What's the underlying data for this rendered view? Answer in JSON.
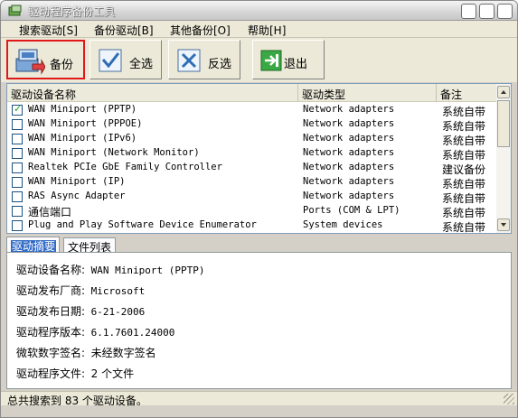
{
  "window": {
    "title": "驱动程序备份工具"
  },
  "menu": [
    {
      "label": "搜索驱动[S]"
    },
    {
      "label": "备份驱动[B]"
    },
    {
      "label": "其他备份[O]"
    },
    {
      "label": "帮助[H]"
    }
  ],
  "toolbar": {
    "backup_label": "备份",
    "select_all_label": "全选",
    "invert_label": "反选",
    "exit_label": "退出"
  },
  "list": {
    "columns": [
      "驱动设备名称",
      "驱动类型",
      "备注"
    ],
    "rows": [
      {
        "checked": true,
        "name": "WAN Miniport (PPTP)",
        "type": "Network adapters",
        "note": "系统自带"
      },
      {
        "checked": false,
        "name": "WAN Miniport (PPPOE)",
        "type": "Network adapters",
        "note": "系统自带"
      },
      {
        "checked": false,
        "name": "WAN Miniport (IPv6)",
        "type": "Network adapters",
        "note": "系统自带"
      },
      {
        "checked": false,
        "name": "WAN Miniport (Network Monitor)",
        "type": "Network adapters",
        "note": "系统自带"
      },
      {
        "checked": false,
        "name": "Realtek PCIe GbE Family Controller",
        "type": "Network adapters",
        "note": "建议备份"
      },
      {
        "checked": false,
        "name": "WAN Miniport (IP)",
        "type": "Network adapters",
        "note": "系统自带"
      },
      {
        "checked": false,
        "name": "RAS Async Adapter",
        "type": "Network adapters",
        "note": "系统自带"
      },
      {
        "checked": false,
        "name": "通信端口",
        "type": "Ports (COM & LPT)",
        "note": "系统自带"
      },
      {
        "checked": false,
        "name": "Plug and Play Software Device Enumerator",
        "type": "System devices",
        "note": "系统自带"
      }
    ]
  },
  "tabs": [
    {
      "label": "驱动摘要",
      "active": true
    },
    {
      "label": "文件列表",
      "active": false
    }
  ],
  "detail": {
    "rows": [
      {
        "key": "驱动设备名称:",
        "value": "WAN Miniport (PPTP)"
      },
      {
        "key": "驱动发布厂商:",
        "value": "Microsoft"
      },
      {
        "key": "驱动发布日期:",
        "value": "6-21-2006"
      },
      {
        "key": "驱动程序版本:",
        "value": "6.1.7601.24000"
      },
      {
        "key": "微软数字签名:",
        "value": "未经数字签名"
      },
      {
        "key": "驱动程序文件:",
        "value": "2 个文件"
      }
    ]
  },
  "status": {
    "text": "总共搜索到 83 个驱动设备。"
  },
  "colors": {
    "accent": "#e01818",
    "selection": "#316ac5",
    "face": "#ece9d8"
  },
  "icons": [
    "app-icon",
    "backup-icon",
    "select-all-icon",
    "invert-icon",
    "exit-icon"
  ]
}
